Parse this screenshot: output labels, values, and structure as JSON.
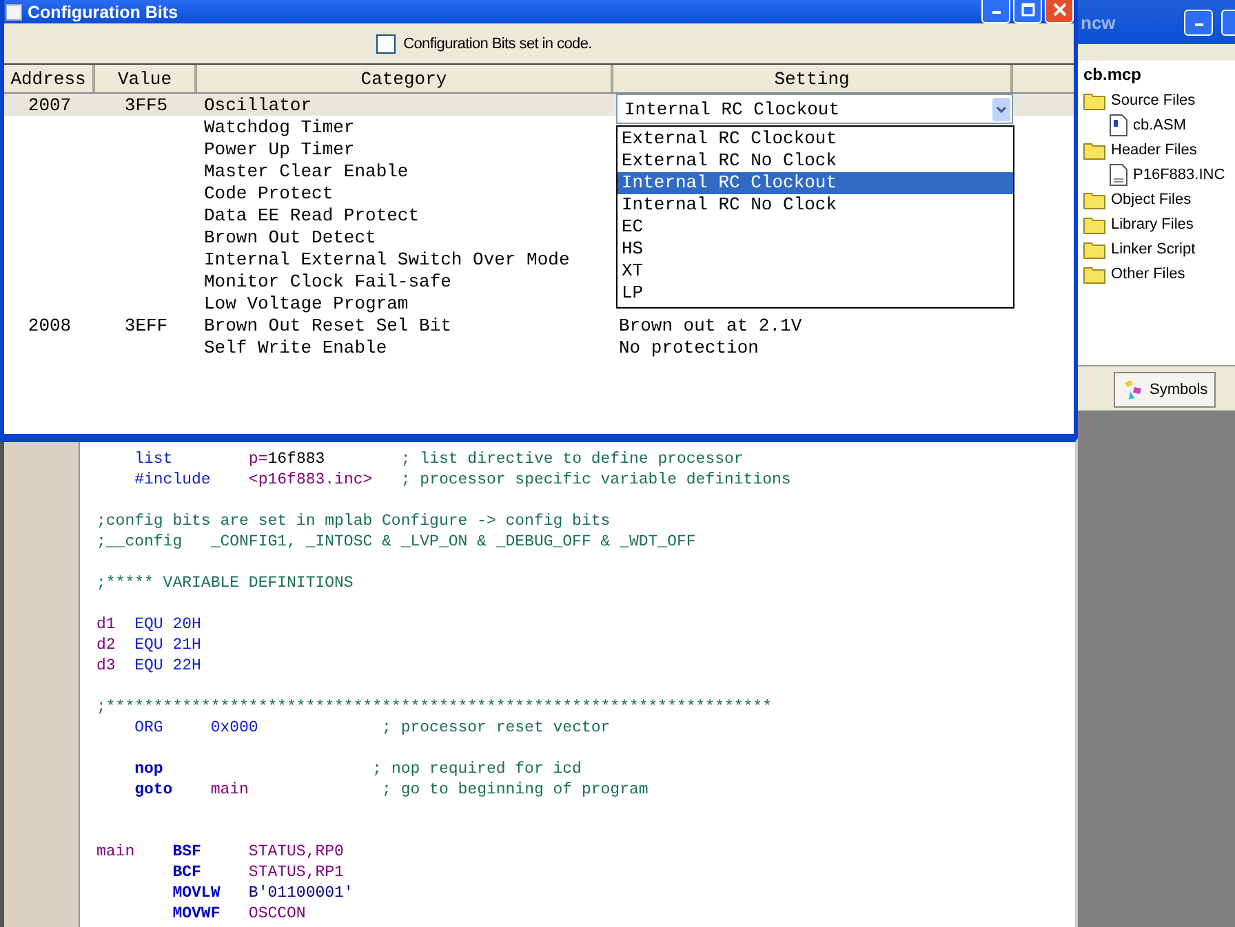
{
  "config_window": {
    "title": "Configuration Bits",
    "checkbox": {
      "label": "Configuration Bits set in code.",
      "checked": false
    },
    "columns": [
      "Address",
      "Value",
      "Category",
      "Setting"
    ],
    "rows": [
      {
        "address": "2007",
        "value": "3FF5",
        "category": "Oscillator",
        "selected": true,
        "setting": "Internal RC Clockout",
        "options": [
          {
            "label": "External RC Clockout",
            "selected": false
          },
          {
            "label": "External RC No Clock",
            "selected": false
          },
          {
            "label": "Internal RC Clockout",
            "selected": true
          },
          {
            "label": "Internal RC No Clock",
            "selected": false
          },
          {
            "label": "EC",
            "selected": false
          },
          {
            "label": "HS",
            "selected": false
          },
          {
            "label": "XT",
            "selected": false
          },
          {
            "label": "LP",
            "selected": false
          }
        ]
      },
      {
        "category": "Watchdog Timer",
        "selected": false
      },
      {
        "category": "Power Up Timer",
        "selected": false
      },
      {
        "category": "Master Clear Enable",
        "selected": false
      },
      {
        "category": "Code Protect",
        "selected": false
      },
      {
        "category": "Data EE Read Protect",
        "selected": false
      },
      {
        "category": "Brown Out Detect",
        "selected": false
      },
      {
        "category": "Internal External Switch Over Mode",
        "selected": false
      },
      {
        "category": "Monitor Clock Fail-safe",
        "selected": false
      },
      {
        "category": "Low Voltage Program",
        "selected": false
      },
      {
        "address": "2008",
        "value": "3EFF",
        "category": "Brown Out Reset Sel Bit",
        "selected": false,
        "setting": "Brown out at 2.1V"
      },
      {
        "category": "Self Write Enable",
        "selected": false,
        "setting": "No protection"
      }
    ]
  },
  "project_window": {
    "title": "ncw",
    "tree": {
      "label": "cb.mcp",
      "children": [
        {
          "label": "Source Files",
          "kind": "folder",
          "children": [
            {
              "label": "cb.ASM",
              "kind": "asm-file"
            }
          ]
        },
        {
          "label": "Header Files",
          "kind": "folder",
          "children": [
            {
              "label": "P16F883.INC",
              "kind": "file"
            }
          ]
        },
        {
          "label": "Object Files",
          "kind": "folder"
        },
        {
          "label": "Library Files",
          "kind": "folder"
        },
        {
          "label": "Linker Script",
          "kind": "folder"
        },
        {
          "label": "Other Files",
          "kind": "folder"
        }
      ]
    },
    "tab": "Symbols"
  },
  "editor": {
    "lines": [
      {
        "kind": "code",
        "tokens": [
          {
            "text": "    list",
            "kind": "directive"
          },
          {
            "text": "        p=",
            "kind": "operand"
          },
          {
            "text": "16f883",
            "kind": "number"
          },
          {
            "text": "        ; list directive to define processor",
            "kind": "comment"
          }
        ]
      },
      {
        "kind": "code",
        "tokens": [
          {
            "text": "    #include",
            "kind": "directive"
          },
          {
            "text": "    <p16f883.inc>",
            "kind": "operand"
          },
          {
            "text": "   ; processor specific variable definitions",
            "kind": "comment"
          }
        ]
      },
      {
        "kind": "blank"
      },
      {
        "kind": "code",
        "tokens": [
          {
            "text": ";config bits are set in mplab Configure -> config bits",
            "kind": "comment"
          }
        ]
      },
      {
        "kind": "code",
        "tokens": [
          {
            "text": ";__config   _CONFIG1, _INTOSC & _LVP_ON & _DEBUG_OFF & _WDT_OFF",
            "kind": "comment"
          }
        ]
      },
      {
        "kind": "blank"
      },
      {
        "kind": "code",
        "tokens": [
          {
            "text": ";***** VARIABLE DEFINITIONS",
            "kind": "comment"
          }
        ]
      },
      {
        "kind": "blank"
      },
      {
        "kind": "code",
        "tokens": [
          {
            "text": "d1",
            "kind": "operand"
          },
          {
            "text": "  EQU 20H",
            "kind": "directive"
          }
        ]
      },
      {
        "kind": "code",
        "tokens": [
          {
            "text": "d2",
            "kind": "operand"
          },
          {
            "text": "  EQU 21H",
            "kind": "directive"
          }
        ]
      },
      {
        "kind": "code",
        "tokens": [
          {
            "text": "d3",
            "kind": "operand"
          },
          {
            "text": "  EQU 22H",
            "kind": "directive"
          }
        ]
      },
      {
        "kind": "blank"
      },
      {
        "kind": "code",
        "tokens": [
          {
            "text": ";**********************************************************************",
            "kind": "comment"
          }
        ]
      },
      {
        "kind": "code",
        "tokens": [
          {
            "text": "    ORG",
            "kind": "directive"
          },
          {
            "text": "     0x000",
            "kind": "directive"
          },
          {
            "text": "             ; processor reset vector",
            "kind": "comment"
          }
        ]
      },
      {
        "kind": "blank"
      },
      {
        "kind": "code",
        "tokens": [
          {
            "text": "    nop",
            "kind": "keyword"
          },
          {
            "text": "                      ; nop required for icd",
            "kind": "comment"
          }
        ]
      },
      {
        "kind": "code",
        "tokens": [
          {
            "text": "    goto",
            "kind": "keyword"
          },
          {
            "text": "    main",
            "kind": "operand"
          },
          {
            "text": "              ; go to beginning of program",
            "kind": "comment"
          }
        ]
      },
      {
        "kind": "blank"
      },
      {
        "kind": "blank"
      },
      {
        "kind": "code",
        "tokens": [
          {
            "text": "main",
            "kind": "operand"
          },
          {
            "text": "    BSF",
            "kind": "keyword"
          },
          {
            "text": "     STATUS,RP0",
            "kind": "operand"
          }
        ]
      },
      {
        "kind": "code",
        "tokens": [
          {
            "text": "        BCF",
            "kind": "keyword"
          },
          {
            "text": "     STATUS,RP1",
            "kind": "operand"
          }
        ]
      },
      {
        "kind": "code",
        "tokens": [
          {
            "text": "        MOVLW",
            "kind": "keyword"
          },
          {
            "text": "   B'01100001'",
            "kind": "literal"
          }
        ]
      },
      {
        "kind": "code",
        "tokens": [
          {
            "text": "        MOVWF",
            "kind": "keyword"
          },
          {
            "text": "   OSCCON",
            "kind": "operand"
          }
        ]
      }
    ]
  }
}
